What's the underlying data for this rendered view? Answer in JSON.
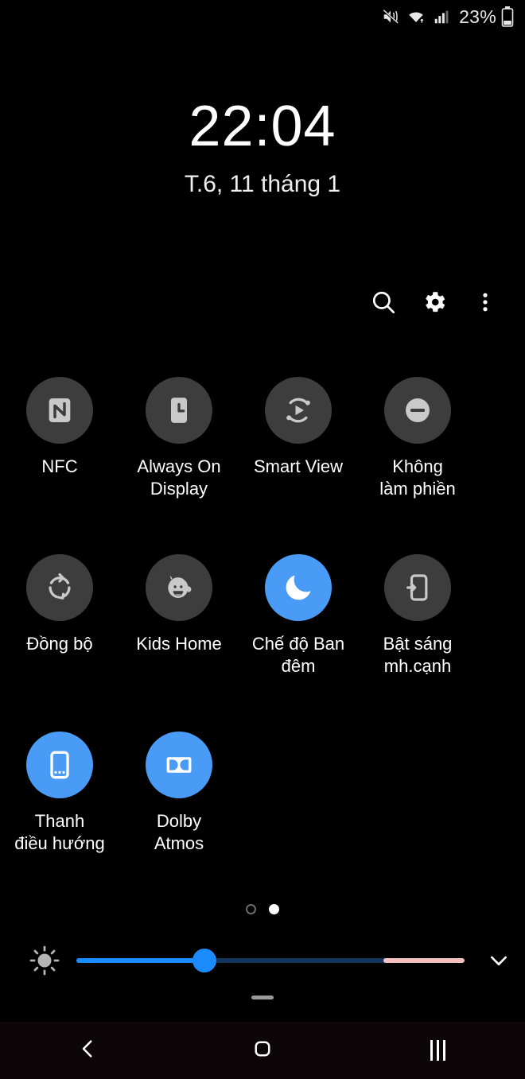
{
  "status_bar": {
    "icons": [
      "mute-vibrate-icon",
      "wifi-icon",
      "signal-icon"
    ],
    "battery_percent": "23%",
    "battery_icon": "battery-icon"
  },
  "clock": {
    "time": "22:04",
    "date": "T.6, 11 tháng 1"
  },
  "header": {
    "buttons": [
      {
        "name": "search-icon",
        "label": "Search"
      },
      {
        "name": "gear-icon",
        "label": "Settings"
      },
      {
        "name": "more-options-icon",
        "label": "More options"
      }
    ]
  },
  "tiles": {
    "rows": [
      [
        {
          "label": "NFC",
          "icon": "nfc-icon",
          "active": false
        },
        {
          "label": "Always On\nDisplay",
          "icon": "always-on-display-icon",
          "active": false
        },
        {
          "label": "Smart View",
          "icon": "smart-view-icon",
          "active": false
        },
        {
          "label": "Không\nlàm phiền",
          "icon": "do-not-disturb-icon",
          "active": false
        }
      ],
      [
        {
          "label": "Đồng bộ",
          "icon": "sync-icon",
          "active": false
        },
        {
          "label": "Kids Home",
          "icon": "kids-home-icon",
          "active": false
        },
        {
          "label": "Chế độ Ban\nđêm",
          "icon": "night-mode-icon",
          "active": true
        },
        {
          "label": "Bật sáng\nmh.cạnh",
          "icon": "edge-lighting-icon",
          "active": false
        }
      ],
      [
        {
          "label": "Thanh\nđiều hướng",
          "icon": "navigation-bar-icon",
          "active": true
        },
        {
          "label": "Dolby\nAtmos",
          "icon": "dolby-atmos-icon",
          "active": true
        }
      ]
    ]
  },
  "page_indicator": {
    "total": 2,
    "current": 2
  },
  "brightness": {
    "icon": "brightness-sun-icon",
    "value_percent": 33,
    "extra_zone_start_percent": 79,
    "expand_icon": "chevron-down-icon"
  },
  "panel_handle": "panel-drag-handle",
  "nav_bar": {
    "buttons": [
      {
        "name": "back-button",
        "icon": "chevron-left-icon"
      },
      {
        "name": "home-button",
        "icon": "home-square-icon"
      },
      {
        "name": "recents-button",
        "icon": "recents-bars-icon"
      }
    ]
  },
  "colors": {
    "accent": "#4a9bf5",
    "slider_fill": "#1a8cff",
    "slider_extra": "#f4c0bd",
    "tile_off": "#3d3d3d",
    "background": "#000000"
  }
}
